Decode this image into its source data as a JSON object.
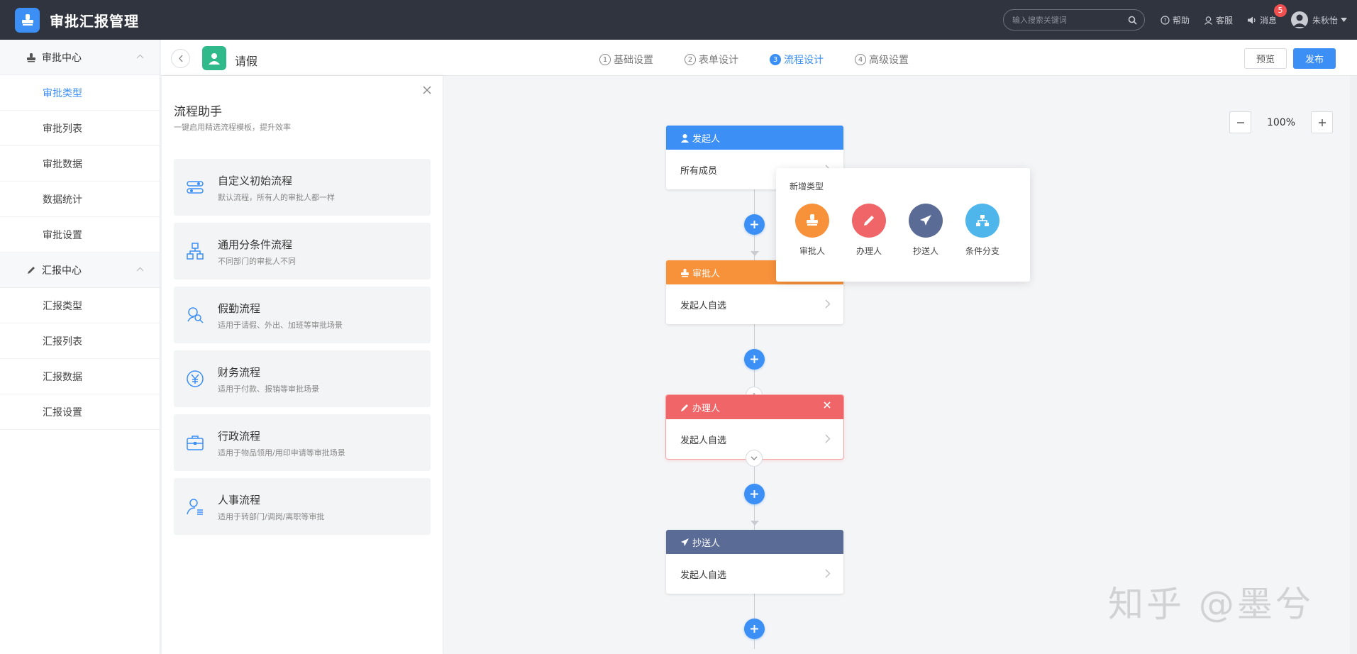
{
  "app": {
    "title": "审批汇报管理"
  },
  "topbar": {
    "search_placeholder": "输入搜索关键词",
    "help": "帮助",
    "service": "客服",
    "messages": "消息",
    "message_count": "5",
    "user_name": "朱秋怡"
  },
  "sidebar": {
    "group1": "审批中心",
    "group1_items": [
      "审批类型",
      "审批列表",
      "审批数据",
      "数据统计",
      "审批设置"
    ],
    "group2": "汇报中心",
    "group2_items": [
      "汇报类型",
      "汇报列表",
      "汇报数据",
      "汇报设置"
    ]
  },
  "subheader": {
    "form_name": "请假",
    "steps": [
      {
        "num": "1",
        "label": "基础设置"
      },
      {
        "num": "2",
        "label": "表单设计"
      },
      {
        "num": "3",
        "label": "流程设计"
      },
      {
        "num": "4",
        "label": "高级设置"
      }
    ],
    "preview": "预览",
    "publish": "发布"
  },
  "assistant": {
    "title": "流程助手",
    "subtitle": "一键启用精选流程模板，提升效率",
    "templates": [
      {
        "name": "自定义初始流程",
        "desc": "默认流程，所有人的审批人都一样",
        "icon": "sliders-icon"
      },
      {
        "name": "通用分条件流程",
        "desc": "不同部门的审批人不同",
        "icon": "org-chart-icon"
      },
      {
        "name": "假勤流程",
        "desc": "适用于请假、外出、加班等审批场景",
        "icon": "person-search-icon"
      },
      {
        "name": "财务流程",
        "desc": "适用于付款、报销等审批场景",
        "icon": "yen-icon"
      },
      {
        "name": "行政流程",
        "desc": "适用于物品领用/用印申请等审批场景",
        "icon": "briefcase-icon"
      },
      {
        "name": "人事流程",
        "desc": "适用于转部门/调岗/离职等审批",
        "icon": "person-list-icon"
      }
    ]
  },
  "zoom": {
    "value": "100%"
  },
  "flow": {
    "nodes": [
      {
        "title": "发起人",
        "body": "所有成员",
        "color": "#3b8ff5"
      },
      {
        "title": "审批人",
        "body": "发起人自选",
        "color": "#f7913a"
      },
      {
        "title": "办理人",
        "body": "发起人自选",
        "color": "#f06567"
      },
      {
        "title": "抄送人",
        "body": "发起人自选",
        "color": "#5a6b96"
      }
    ]
  },
  "popover": {
    "title": "新增类型",
    "options": [
      {
        "label": "审批人",
        "color": "#f7913a"
      },
      {
        "label": "办理人",
        "color": "#f06567"
      },
      {
        "label": "抄送人",
        "color": "#5a6b96"
      },
      {
        "label": "条件分支",
        "color": "#4fb6ec"
      }
    ]
  },
  "watermark": "知乎 @墨兮"
}
